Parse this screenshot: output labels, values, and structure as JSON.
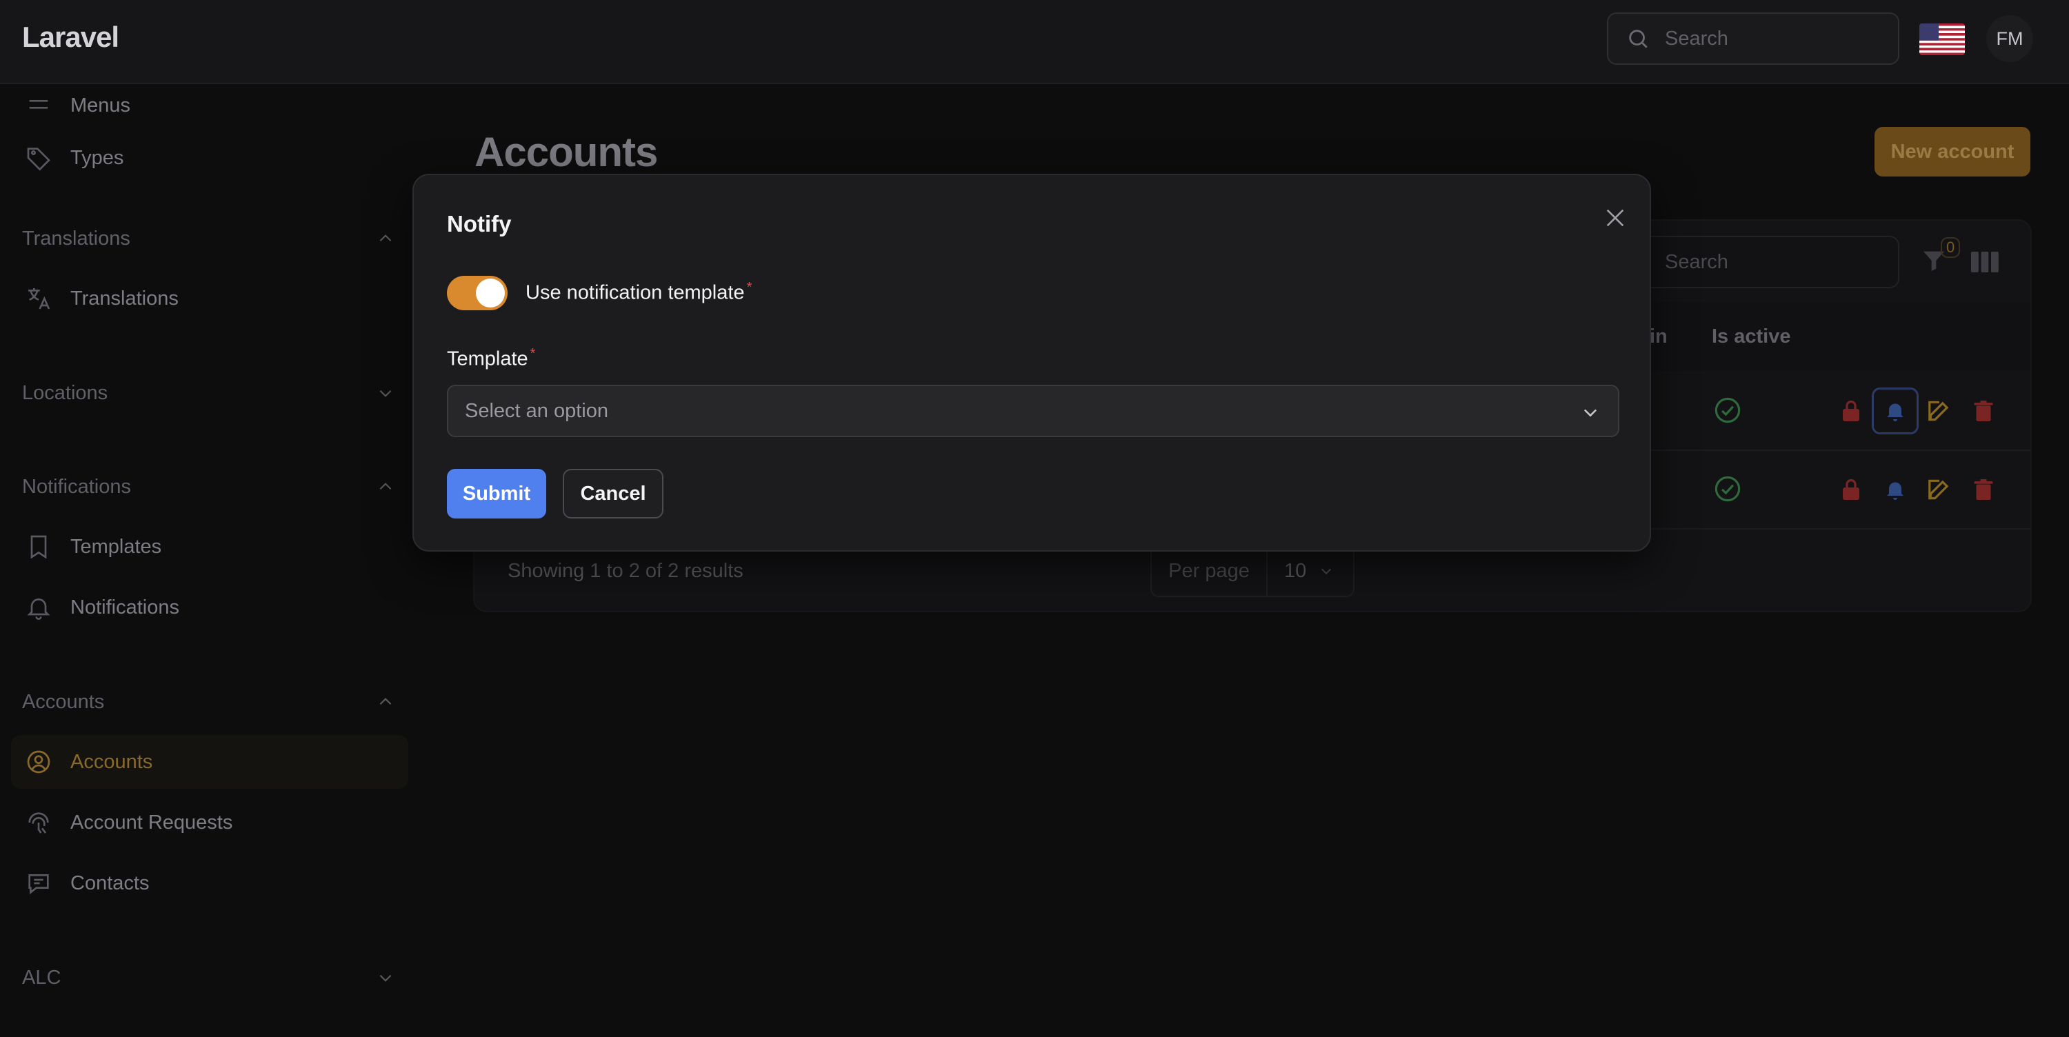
{
  "topbar": {
    "brand": "Laravel",
    "search_placeholder": "Search",
    "avatar_initials": "FM"
  },
  "sidebar": {
    "items_top": [
      {
        "label": "Menus",
        "icon": "menu-icon"
      },
      {
        "label": "Types",
        "icon": "tag-icon"
      }
    ],
    "groups": [
      {
        "label": "Translations",
        "expanded": true,
        "items": [
          {
            "label": "Translations",
            "icon": "translate-icon"
          }
        ]
      },
      {
        "label": "Locations",
        "expanded": false,
        "items": []
      },
      {
        "label": "Notifications",
        "expanded": true,
        "items": [
          {
            "label": "Templates",
            "icon": "bookmark-icon"
          },
          {
            "label": "Notifications",
            "icon": "bell-icon"
          }
        ]
      },
      {
        "label": "Accounts",
        "expanded": true,
        "items": [
          {
            "label": "Accounts",
            "icon": "user-circle-icon",
            "active": true
          },
          {
            "label": "Account Requests",
            "icon": "fingerprint-icon"
          },
          {
            "label": "Contacts",
            "icon": "chat-icon"
          }
        ]
      },
      {
        "label": "ALC",
        "expanded": false,
        "items": []
      }
    ]
  },
  "main": {
    "title": "Accounts",
    "new_button": "New account",
    "table_search_placeholder": "Search",
    "filter_count": "0",
    "columns": [
      "in",
      "Is active"
    ],
    "footer": "Showing 1 to 2 of 2 results",
    "per_page_label": "Per page",
    "per_page_value": "10"
  },
  "modal": {
    "title": "Notify",
    "toggle_label": "Use notification template",
    "toggle_on": true,
    "field_label": "Template",
    "select_placeholder": "Select an option",
    "required_mark": "*",
    "submit": "Submit",
    "cancel": "Cancel"
  },
  "colors": {
    "accent": "#d98a2e",
    "primary_button": "#4f80ee",
    "danger": "#9a2a2a"
  }
}
